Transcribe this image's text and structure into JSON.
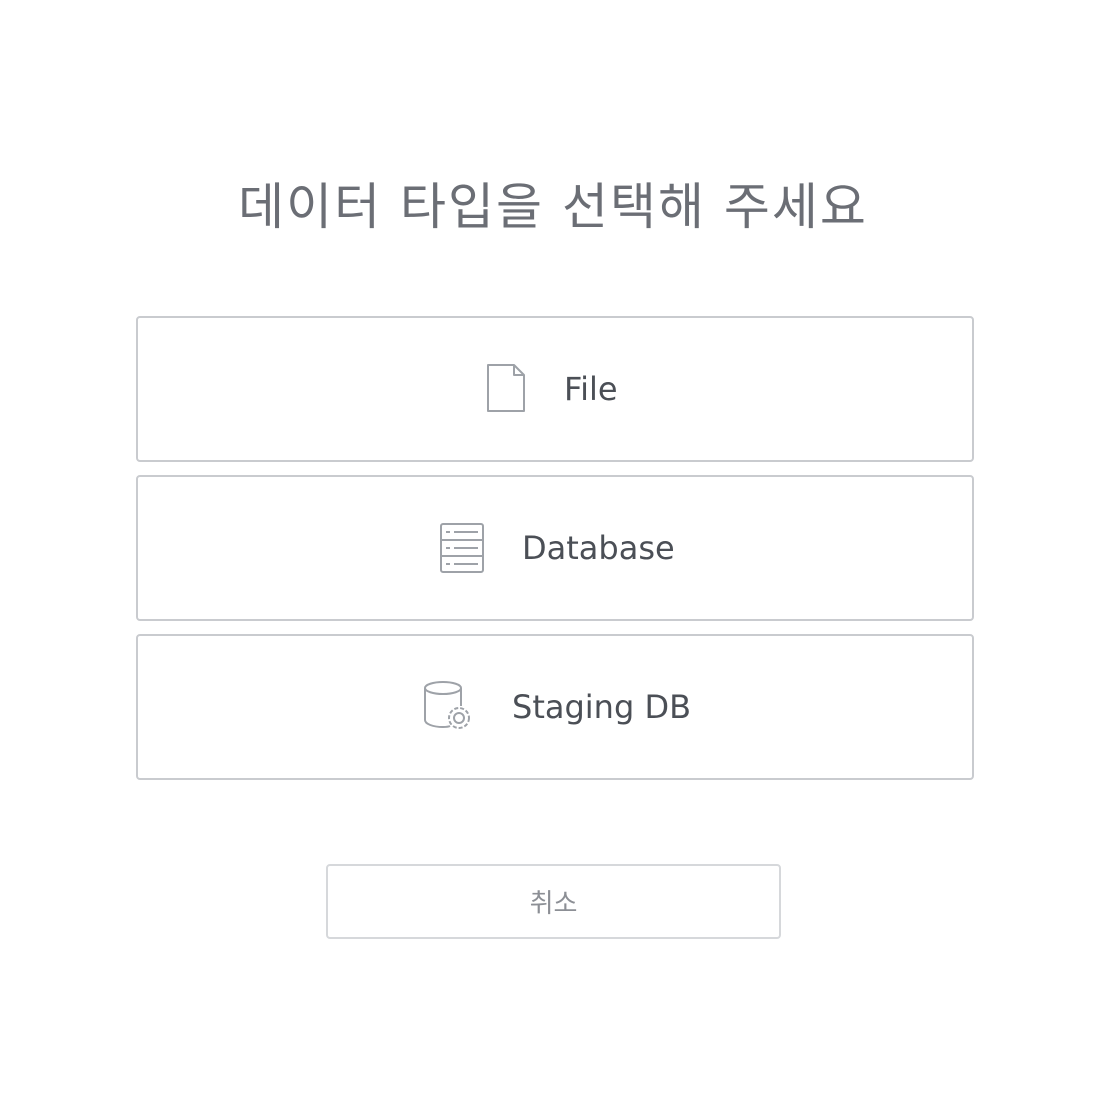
{
  "dialog": {
    "title": "데이터 타입을 선택해 주세요",
    "options": [
      {
        "label": "File",
        "icon": "file-icon"
      },
      {
        "label": "Database",
        "icon": "database-server-icon"
      },
      {
        "label": "Staging DB",
        "icon": "staging-db-icon"
      }
    ],
    "cancel_label": "취소"
  }
}
